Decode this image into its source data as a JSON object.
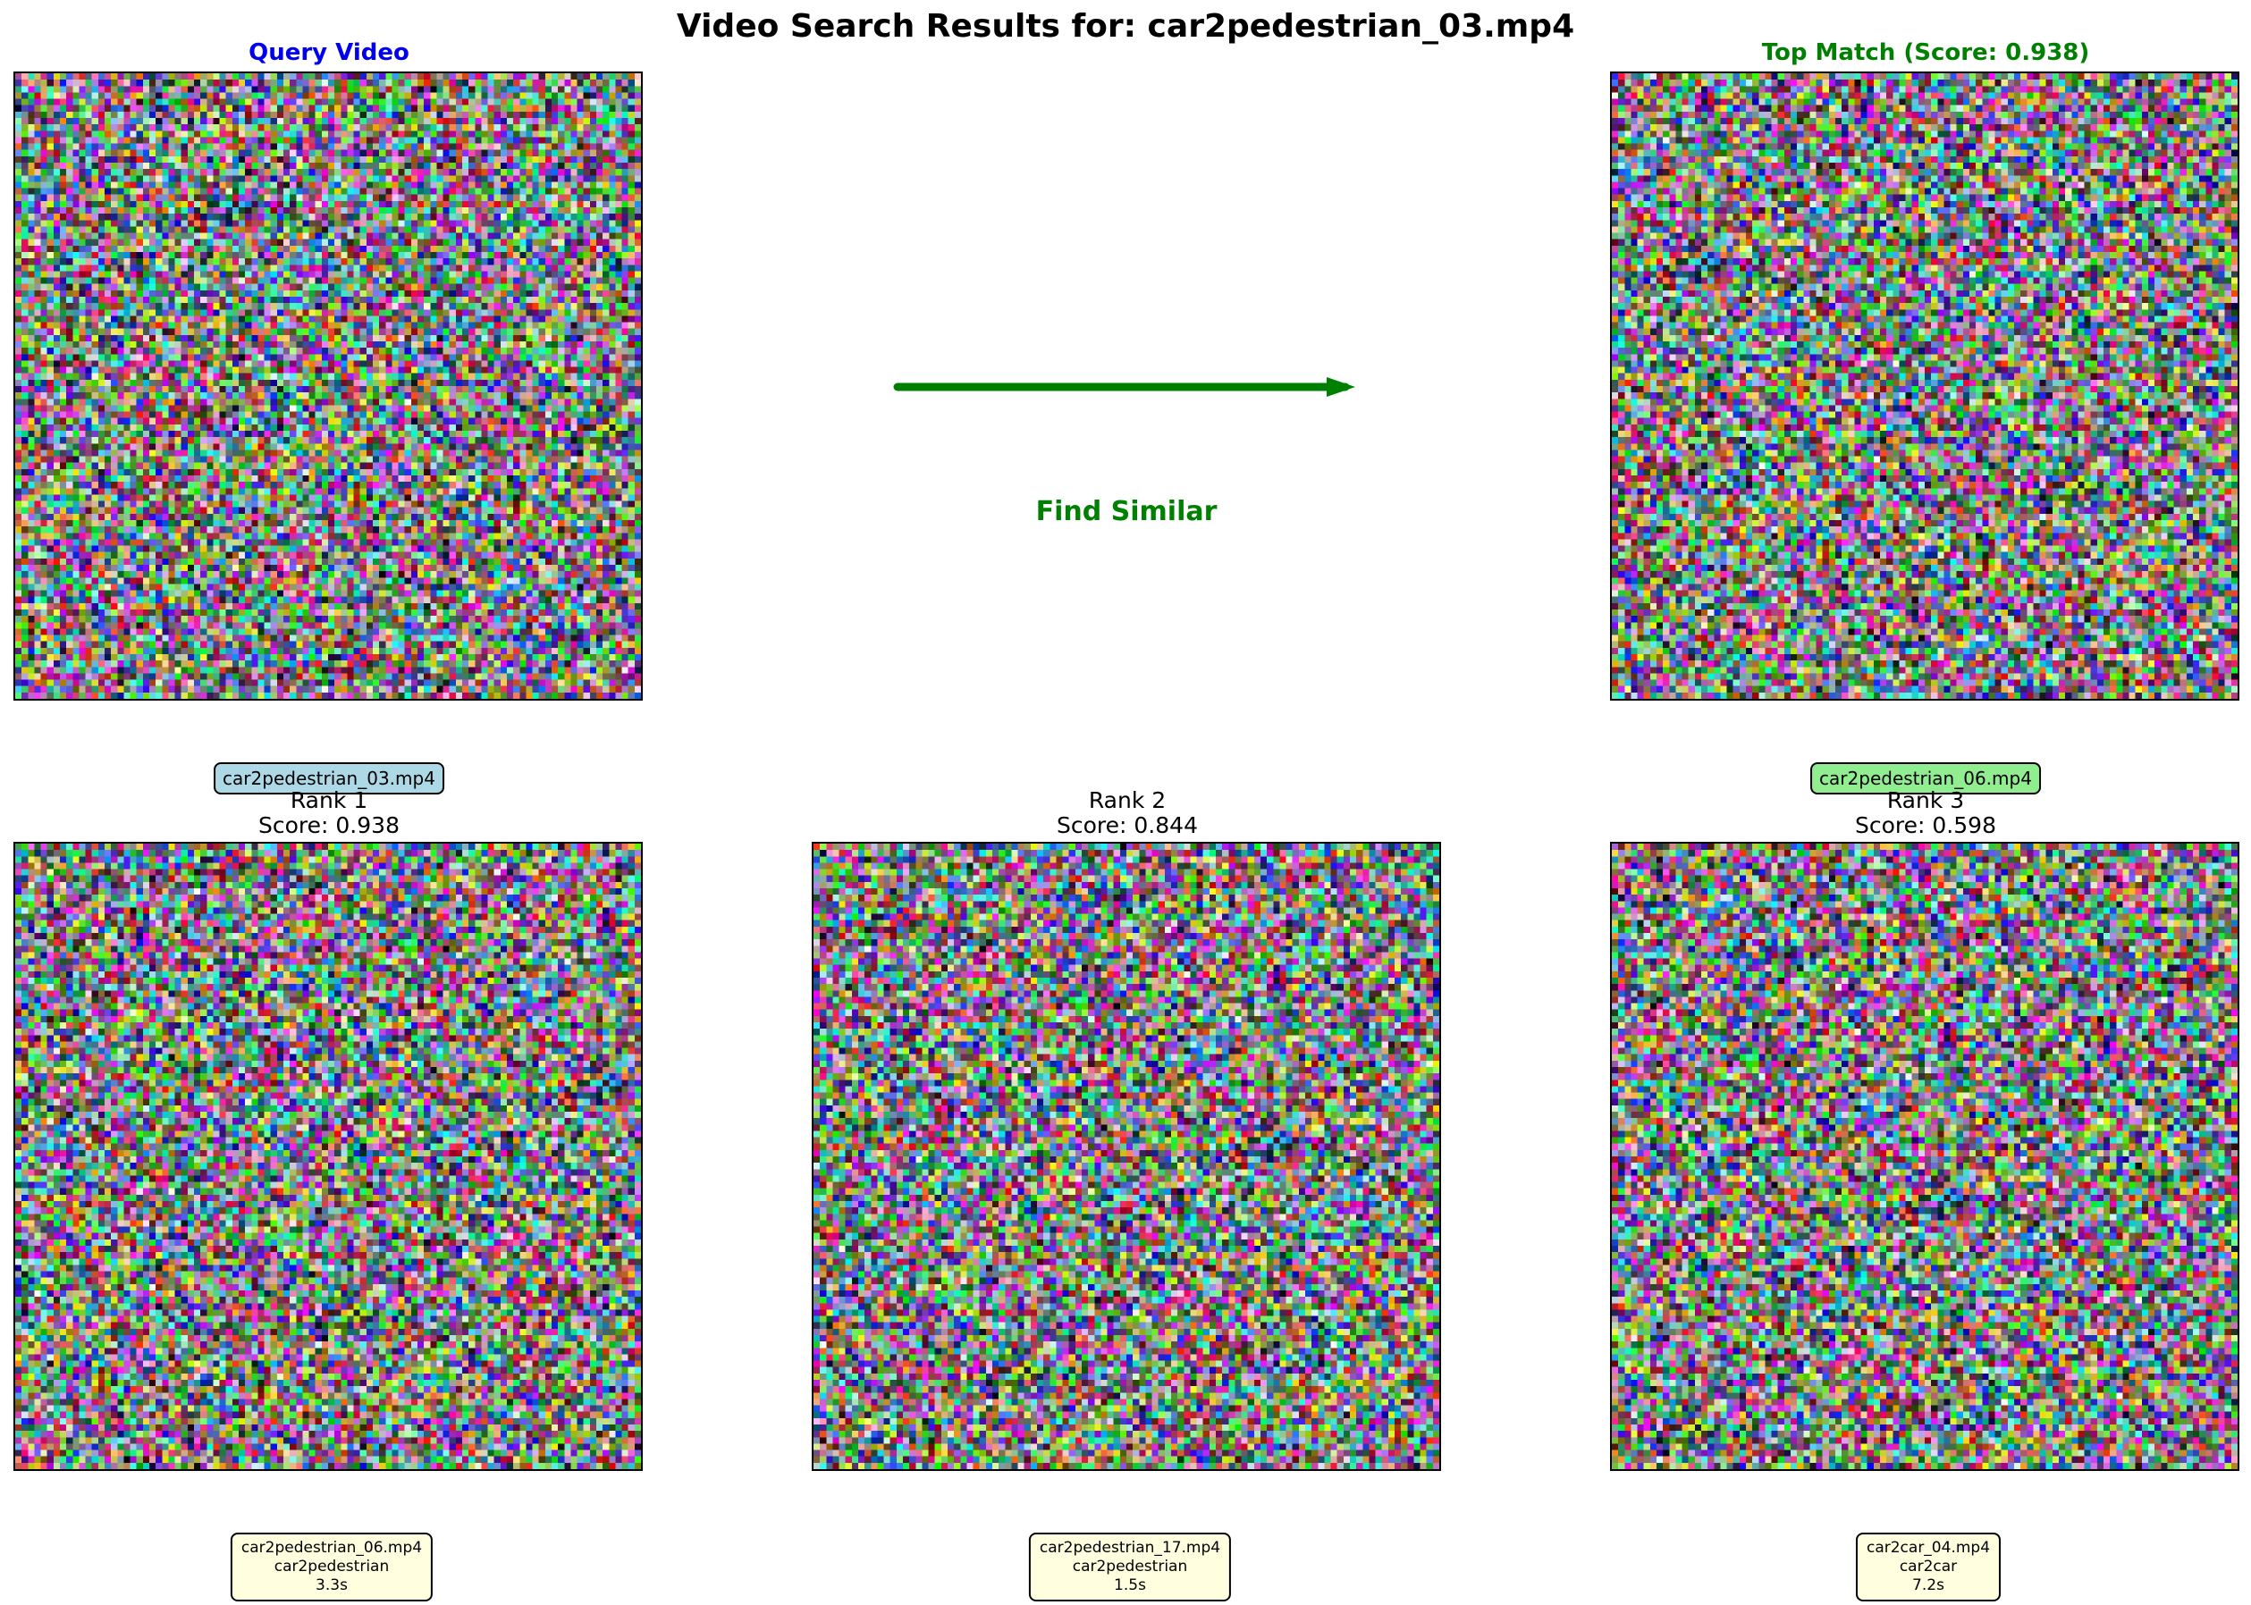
{
  "title": "Video Search Results for: car2pedestrian_03.mp4",
  "query": {
    "title": "Query Video",
    "title_color": "#0000ee",
    "filename": "car2pedestrian_03.mp4",
    "label_bg": "#add8e6"
  },
  "arrow": {
    "label": "Find Similar",
    "color": "#008000"
  },
  "top_match": {
    "title": "Top Match (Score: 0.938)",
    "title_color": "#008000",
    "filename": "car2pedestrian_06.mp4",
    "label_bg": "#90ee90"
  },
  "results": [
    {
      "rank_label": "Rank 1",
      "score_label": "Score: 0.938",
      "filename": "car2pedestrian_06.mp4",
      "category": "car2pedestrian",
      "duration": "3.3s"
    },
    {
      "rank_label": "Rank 2",
      "score_label": "Score: 0.844",
      "filename": "car2pedestrian_17.mp4",
      "category": "car2pedestrian",
      "duration": "1.5s"
    },
    {
      "rank_label": "Rank 3",
      "score_label": "Score: 0.598",
      "filename": "car2car_04.mp4",
      "category": "car2car",
      "duration": "7.2s"
    }
  ],
  "info_box_bg": "#ffffe0",
  "frame_image": "random-color-noise"
}
